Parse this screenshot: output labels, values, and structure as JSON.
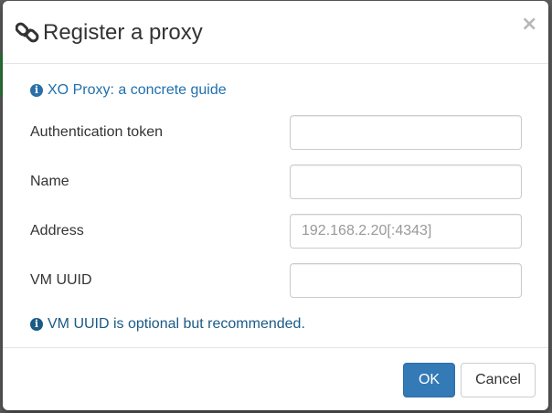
{
  "dialog": {
    "title": "Register a proxy",
    "close_glyph": "×",
    "title_icon": "link-icon"
  },
  "guide_link": {
    "icon": "info-circle-icon",
    "label": "XO Proxy: a concrete guide"
  },
  "form": {
    "fields": [
      {
        "label": "Authentication token",
        "value": "",
        "placeholder": ""
      },
      {
        "label": "Name",
        "value": "",
        "placeholder": ""
      },
      {
        "label": "Address",
        "value": "",
        "placeholder": "192.168.2.20[:4343]"
      },
      {
        "label": "VM UUID",
        "value": "",
        "placeholder": ""
      }
    ],
    "hint": "VM UUID is optional but recommended."
  },
  "footer": {
    "ok_label": "OK",
    "cancel_label": "Cancel"
  },
  "colors": {
    "primary": "#337ab7",
    "link": "#1f6fae",
    "hint": "#1a5a86"
  }
}
